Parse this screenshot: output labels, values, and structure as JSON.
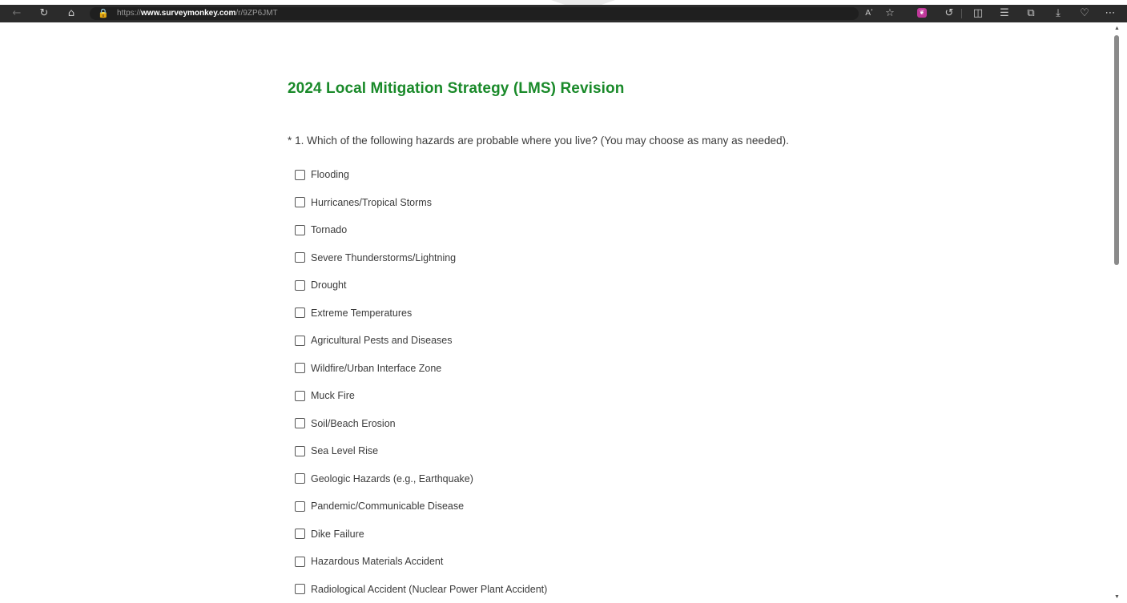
{
  "browser": {
    "url_prefix": "https://",
    "url_domain": "www.surveymonkey.com",
    "url_path": "/r/9ZP6JMT",
    "read_aloud_label": "Aʹ",
    "extension_badge": "❦"
  },
  "survey": {
    "title": "2024 Local Mitigation Strategy (LMS) Revision",
    "question": "* 1. Which of the following hazards are probable where you live? (You may choose as many as needed).",
    "options": [
      "Flooding",
      "Hurricanes/Tropical Storms",
      "Tornado",
      "Severe Thunderstorms/Lightning",
      "Drought",
      "Extreme Temperatures",
      "Agricultural Pests and Diseases",
      "Wildfire/Urban Interface Zone",
      "Muck Fire",
      "Soil/Beach Erosion",
      "Sea Level Rise",
      "Geologic Hazards (e.g., Earthquake)",
      "Pandemic/Communicable Disease",
      "Dike Failure",
      "Hazardous Materials Accident",
      "Radiological Accident (Nuclear Power Plant Accident)"
    ]
  },
  "colors": {
    "title": "#1a8a2a",
    "toolbar": "#2b2b2b",
    "text": "#3b3b3b"
  }
}
